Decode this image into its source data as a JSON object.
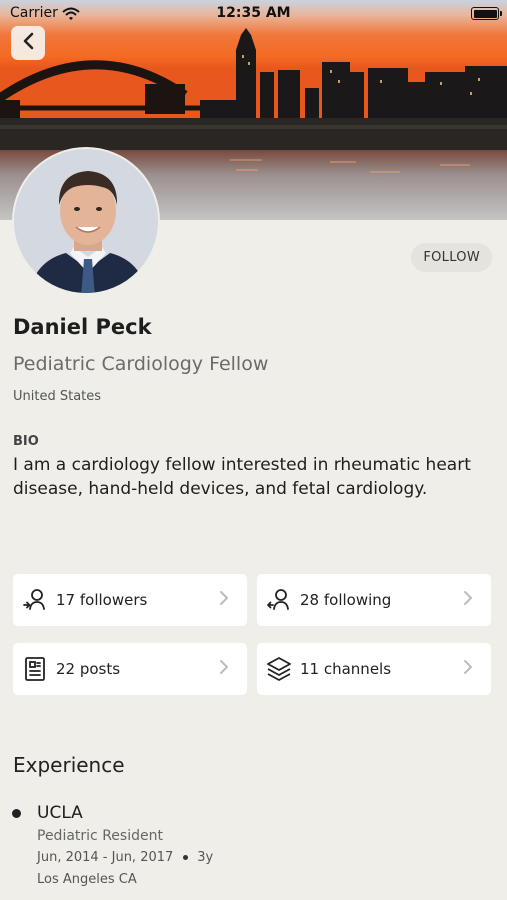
{
  "status_bar": {
    "carrier": "Carrier",
    "time": "12:35 AM"
  },
  "colors": {
    "accent_dark": "#222222",
    "card_bg": "#ffffff",
    "page_bg": "#efeee8",
    "sky_orange": "#f26a2b"
  },
  "header": {
    "back_icon": "chevron-left-icon",
    "follow_label": "FOLLOW"
  },
  "profile": {
    "name": "Daniel Peck",
    "title": "Pediatric Cardiology Fellow",
    "country": "United States",
    "bio_label": "BIO",
    "bio": "I am a cardiology fellow interested in rheumatic heart disease, hand-held devices, and fetal cardiology."
  },
  "stats": [
    {
      "label": "17 followers",
      "icon": "followers-icon"
    },
    {
      "label": "28 following",
      "icon": "following-icon"
    },
    {
      "label": "22 posts",
      "icon": "posts-icon"
    },
    {
      "label": "11 channels",
      "icon": "channels-icon"
    }
  ],
  "experience": {
    "heading": "Experience",
    "items": [
      {
        "organization": "UCLA",
        "role": "Pediatric Resident",
        "dates": "Jun, 2014 - Jun, 2017",
        "duration": "3y",
        "location": "Los Angeles CA"
      }
    ]
  }
}
